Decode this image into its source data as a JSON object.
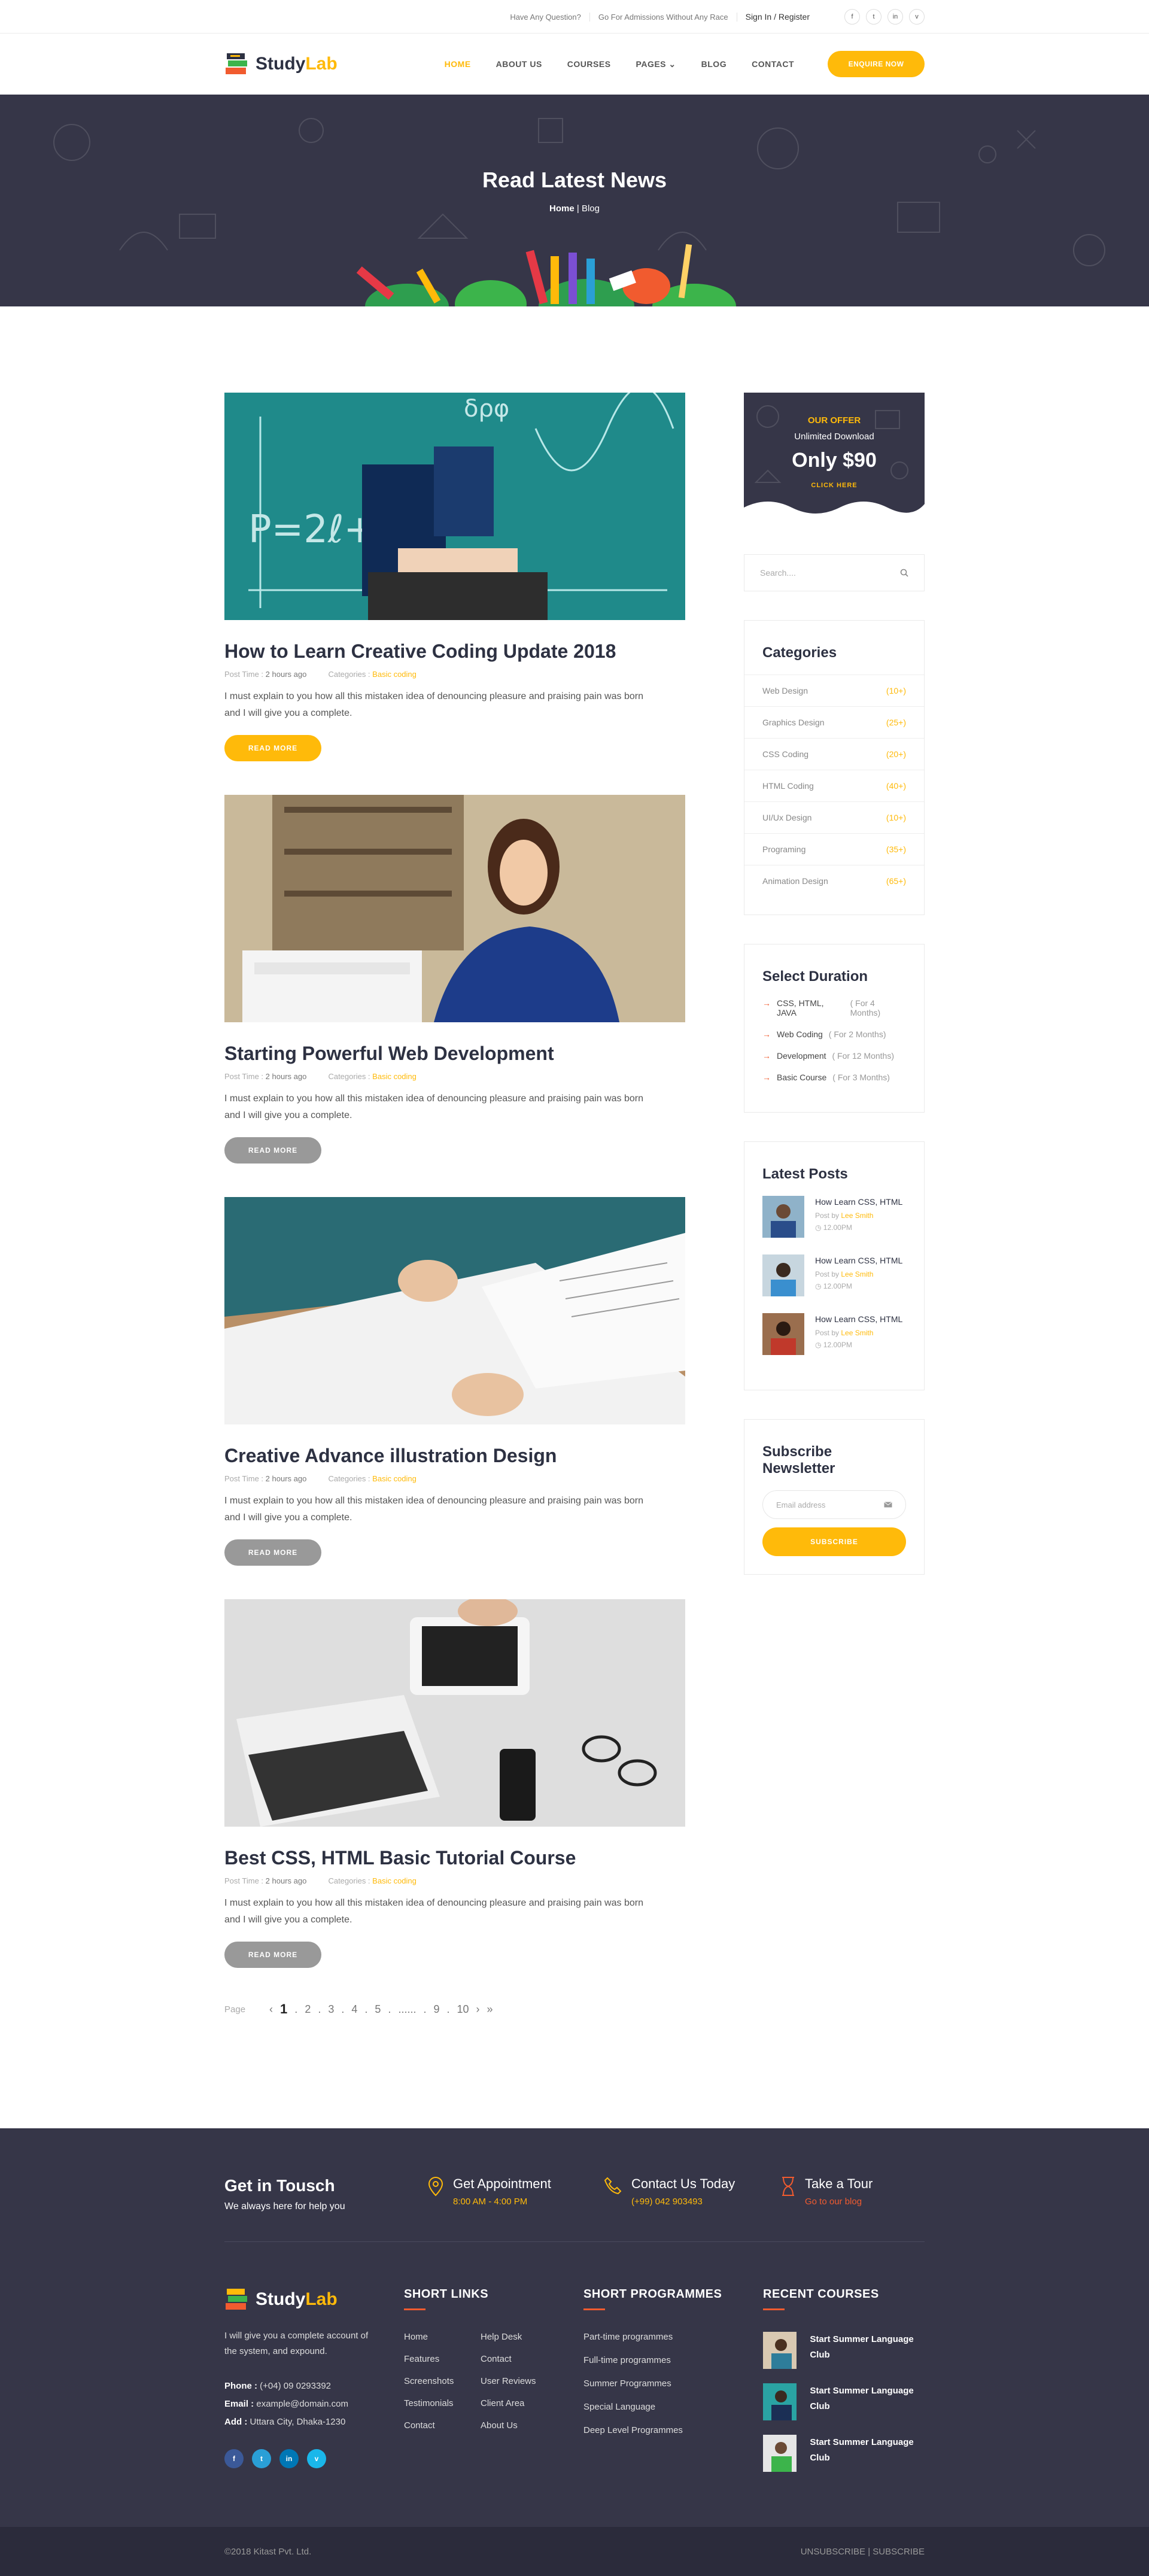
{
  "topbar": {
    "question": "Have Any Question?",
    "admission": "Go For Admissions Without Any Race",
    "login": "Sign In / Register",
    "social": [
      "f",
      "t",
      "in",
      "v"
    ]
  },
  "header": {
    "logo_study": "Study",
    "logo_lab": "Lab",
    "nav": [
      "HOME",
      "ABOUT US",
      "COURSES",
      "PAGES",
      "BLOG",
      "CONTACT"
    ],
    "pages_caret": "⌄",
    "cta": "ENQUIRE NOW"
  },
  "banner": {
    "title": "Read Latest News",
    "crumb_home": "Home",
    "crumb_sep": "|",
    "crumb_current": "Blog"
  },
  "posts": [
    {
      "title": "How to Learn Creative Coding Update 2018",
      "time_label": "Post Time :",
      "time": "2 hours ago",
      "cat_label": "Categories :",
      "cat": "Basic coding",
      "excerpt": "I must explain to you how all this mistaken idea of denouncing pleasure and praising pain was born and I will give you a complete.",
      "button": "READ MORE"
    },
    {
      "title": "Starting Powerful Web Development",
      "time_label": "Post Time :",
      "time": "2 hours ago",
      "cat_label": "Categories :",
      "cat": "Basic coding",
      "excerpt": "I must explain to you how all this mistaken idea of denouncing pleasure and praising pain was born and I will give you a complete.",
      "button": "READ MORE"
    },
    {
      "title": "Creative Advance illustration Design",
      "time_label": "Post Time :",
      "time": "2 hours ago",
      "cat_label": "Categories :",
      "cat": "Basic coding",
      "excerpt": "I must explain to you how all this mistaken idea of denouncing pleasure and praising pain was born and I will give you a complete.",
      "button": "READ MORE"
    },
    {
      "title": "Best CSS, HTML Basic Tutorial Course",
      "time_label": "Post Time :",
      "time": "2 hours ago",
      "cat_label": "Categories :",
      "cat": "Basic coding",
      "excerpt": "I must explain to you how all this mistaken idea of denouncing pleasure and praising pain was born and I will give you a complete.",
      "button": "READ MORE"
    }
  ],
  "pager": {
    "label": "Page",
    "prev": "‹",
    "items": [
      "1",
      ".",
      "2",
      ".",
      "3",
      ".",
      "4",
      ".",
      "5",
      ".",
      "......",
      ".",
      "9",
      ".",
      "10"
    ],
    "next": "›",
    "last": "»"
  },
  "sidebar": {
    "offer": {
      "kicker": "OUR OFFER",
      "line": "Unlimited Download",
      "price": "Only $90",
      "cta": "CLICK HERE"
    },
    "search_placeholder": "Search....",
    "categories_title": "Categories",
    "categories": [
      {
        "name": "Web Design",
        "count": "(10+)"
      },
      {
        "name": "Graphics Design",
        "count": "(25+)"
      },
      {
        "name": "CSS Coding",
        "count": "(20+)"
      },
      {
        "name": "HTML Coding",
        "count": "(40+)"
      },
      {
        "name": "UI/Ux Design",
        "count": "(10+)"
      },
      {
        "name": "Programing",
        "count": "(35+)"
      },
      {
        "name": "Animation Design",
        "count": "(65+)"
      }
    ],
    "duration_title": "Select Duration",
    "durations": [
      {
        "name": "CSS, HTML, JAVA",
        "dur": "( For 4 Months)"
      },
      {
        "name": "Web Coding",
        "dur": "( For 2 Months)"
      },
      {
        "name": "Development",
        "dur": "( For 12 Months)"
      },
      {
        "name": "Basic Course",
        "dur": "( For 3 Months)"
      }
    ],
    "latest_title": "Latest Posts",
    "latest": [
      {
        "title": "How Learn CSS, HTML",
        "by": "Post by",
        "author": "Lee Smith",
        "time": "◷ 12.00PM"
      },
      {
        "title": "How Learn CSS, HTML",
        "by": "Post by",
        "author": "Lee Smith",
        "time": "◷ 12.00PM"
      },
      {
        "title": "How Learn CSS, HTML",
        "by": "Post by",
        "author": "Lee Smith",
        "time": "◷ 12.00PM"
      }
    ],
    "newsletter_title": "Subscribe Newsletter",
    "newsletter_placeholder": "Email address",
    "newsletter_button": "SUBSCRIBE"
  },
  "footer": {
    "get_title": "Get in Tousch",
    "get_sub": "We always here for help you",
    "appointment_title": "Get Appointment",
    "appointment_sub": "8:00 AM - 4:00 PM",
    "contact_title": "Contact Us Today",
    "contact_sub": "(+99) 042 903493",
    "tour_title": "Take a Tour",
    "tour_sub": "Go to our blog",
    "about": "I will give you a complete account of the system, and expound.",
    "phone_label": "Phone :",
    "phone": "(+04) 09 0293392",
    "email_label": "Email :",
    "email": "example@domain.com",
    "add_label": "Add :",
    "add": "Uttara City, Dhaka-1230",
    "social": [
      "f",
      "t",
      "in",
      "v"
    ],
    "short_links_title": "SHORT LINKS",
    "short_links": [
      "Home",
      "Help Desk",
      "Features",
      "Contact",
      "Screenshots",
      "User Reviews",
      "Testimonials",
      "Client Area",
      "Contact",
      "About Us"
    ],
    "programmes_title": "SHORT PROGRAMMES",
    "programmes": [
      "Part-time programmes",
      "Full-time programmes",
      "Summer Programmes",
      "Special Language",
      "Deep Level Programmes"
    ],
    "recent_title": "RECENT COURSES",
    "recent": [
      "Start Summer Language Club",
      "Start Summer Language Club",
      "Start Summer Language Club"
    ],
    "copyright": "©2018 Kitast Pvt. Ltd.",
    "bottom_links": [
      "UNSUBSCRIBE",
      "|",
      "SUBSCRIBE"
    ]
  },
  "colors": {
    "accent": "#ffba0a",
    "dark": "#363648",
    "orange": "#f15b2f"
  }
}
